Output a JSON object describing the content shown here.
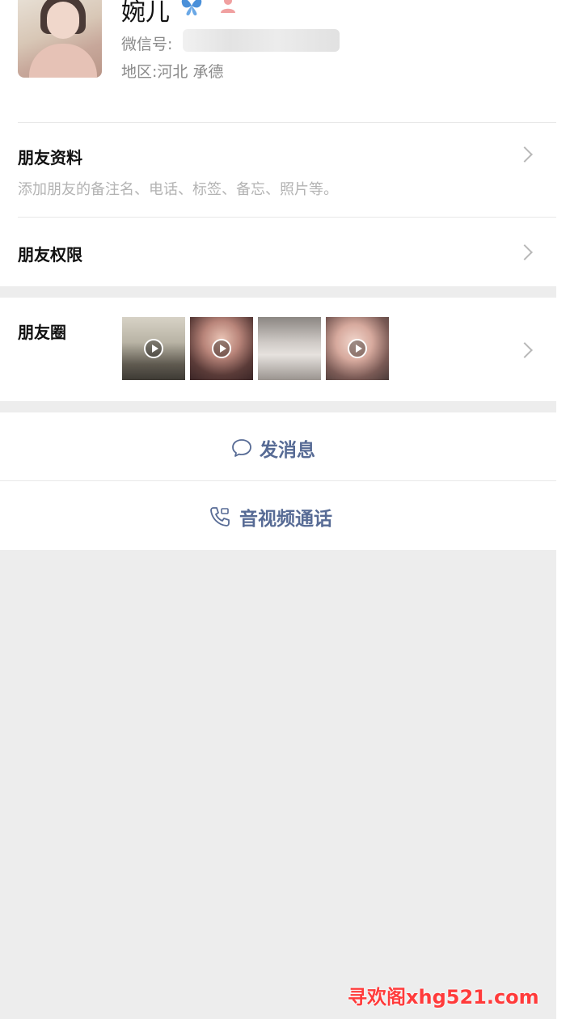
{
  "profile": {
    "name": "婉儿",
    "wechat_id_label": "微信号:",
    "region": "地区:河北 承德",
    "badges": [
      "butterfly-icon",
      "person-icon"
    ]
  },
  "rows": {
    "friend_info": {
      "title": "朋友资料",
      "subtitle": "添加朋友的备注名、电话、标签、备忘、照片等。"
    },
    "friend_permissions": {
      "title": "朋友权限"
    },
    "moments": {
      "title": "朋友圈",
      "thumbnails": [
        {
          "kind": "video",
          "icon": "play-icon"
        },
        {
          "kind": "video",
          "icon": "play-icon"
        },
        {
          "kind": "photo"
        },
        {
          "kind": "video",
          "icon": "play-icon"
        }
      ]
    }
  },
  "actions": {
    "send_message": {
      "label": "发消息",
      "icon": "chat-bubble-icon"
    },
    "av_call": {
      "label": "音视频通话",
      "icon": "phone-call-icon"
    }
  },
  "watermark": "寻欢阁xhg521.com",
  "colors": {
    "accent": "#576b95",
    "background_gray": "#ededed",
    "watermark": "#ff3b3b"
  }
}
